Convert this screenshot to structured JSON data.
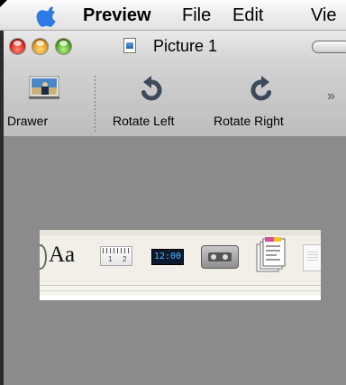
{
  "menubar": {
    "app_name": "Preview",
    "items": [
      "File",
      "Edit",
      "Vie"
    ]
  },
  "window": {
    "title": "Picture 1"
  },
  "toolbar": {
    "items": [
      {
        "label": "Drawer",
        "icon": "drawer-photo-icon"
      },
      {
        "label": "Rotate Left",
        "icon": "rotate-left-icon"
      },
      {
        "label": "Rotate Right",
        "icon": "rotate-right-icon"
      }
    ],
    "overflow": "»"
  },
  "image_strip": {
    "font_sample": "Aa",
    "ruler_numbers": [
      "1",
      "2"
    ],
    "clock_text": "12:00",
    "icons": [
      "font-panel-icon",
      "ruler-icon",
      "clock-icon",
      "cassette-tape-icon",
      "notes-documents-icon",
      "page-icon"
    ]
  },
  "colors": {
    "content_background": "#8b8b8b",
    "close": "#d8271c",
    "minimize": "#e49d18",
    "zoom": "#4ea81f"
  }
}
